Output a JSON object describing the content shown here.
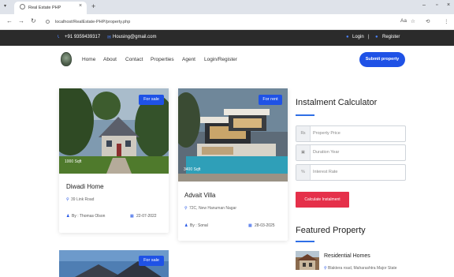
{
  "browser": {
    "tab_title": "Real Estate PHP",
    "url": "localhost/RealEstate-PHP/property.php"
  },
  "topbar": {
    "phone": "+91 9359439317",
    "email": "Housing@gmail.com",
    "login": "Login",
    "separator": "|",
    "register": "Register"
  },
  "nav": {
    "items": [
      "Home",
      "About",
      "Contact",
      "Properties",
      "Agent",
      "Login/Register"
    ],
    "submit": "Submit property"
  },
  "cards": [
    {
      "badge": "For sale",
      "area": "1000 Sqft",
      "title": "Diwadi Home",
      "location": "39 Link Road",
      "agent": "By : Thomas Olson",
      "date": "22-07-2022"
    },
    {
      "badge": "For rent",
      "area": "3400 Sqft",
      "title": "Advait Villa",
      "location": "72C, New Hanuman Nagar",
      "agent": "By : Sonal",
      "date": "28-03-2025"
    },
    {
      "badge": "For sale"
    }
  ],
  "calculator": {
    "title": "Instalment Calculator",
    "fields": [
      {
        "icon": "Rs",
        "placeholder": "Property Price"
      },
      {
        "icon": "▣",
        "placeholder": "Duration Year"
      },
      {
        "icon": "%",
        "placeholder": "Interest Rate"
      }
    ],
    "button": "Calculate Instalment"
  },
  "featured": {
    "title": "Featured Property",
    "item_title": "Residential Homes",
    "item_location": "Blaktera road, Maharashtra Major State"
  },
  "colors": {
    "accent": "#1f52e6",
    "topbar": "#2b2b2b",
    "danger": "#e5304a"
  }
}
